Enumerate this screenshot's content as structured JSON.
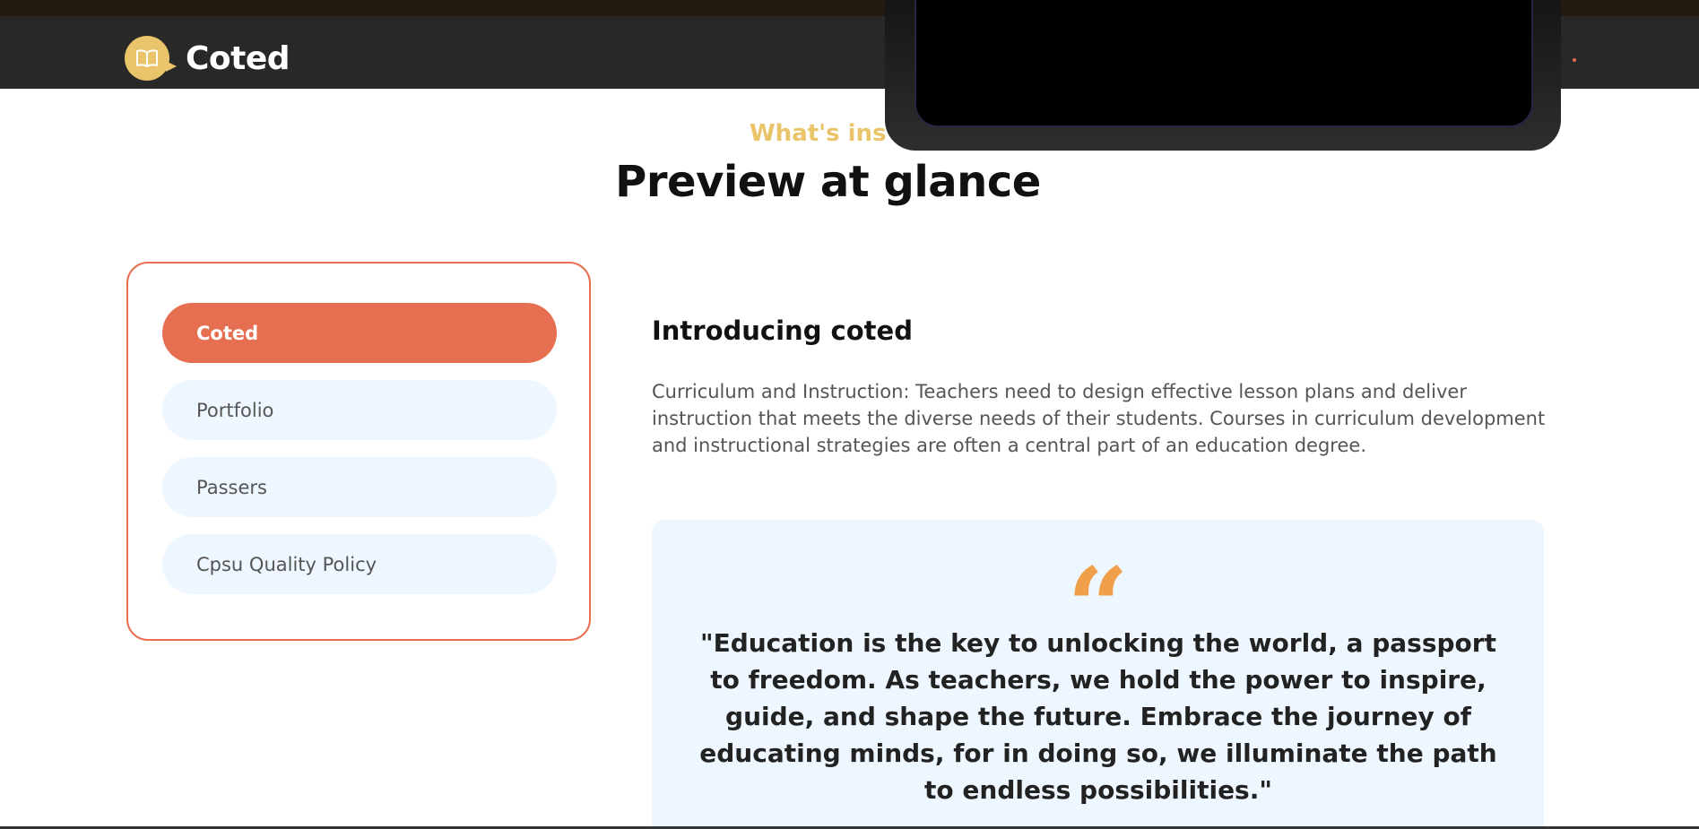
{
  "brand": {
    "name": "Coted",
    "logo_icon": "open-book-icon"
  },
  "section": {
    "eyebrow": "What's ins",
    "title": "Preview at glance"
  },
  "tabs": [
    {
      "label": "Coted",
      "active": true
    },
    {
      "label": "Portfolio",
      "active": false
    },
    {
      "label": "Passers",
      "active": false
    },
    {
      "label": "Cpsu Quality Policy",
      "active": false
    }
  ],
  "content": {
    "title": "Introducing coted",
    "body": "Curriculum and Instruction: Teachers need to design effective lesson plans and deliver instruction that meets the diverse needs of their students. Courses in curriculum development and instructional strategies are often a central part of an education degree.",
    "quote_icon": "quote-icon",
    "quote_mark": "“",
    "quote": "\"Education is the key to unlocking the world, a passport to freedom. As teachers, we hold the power to inspire, guide, and shape the future. Embrace the journey of educating minds, for in doing so, we illuminate the path to endless possibilities.\""
  },
  "colors": {
    "accent": "#e76f51",
    "gold": "#e9c46a",
    "nav_bg": "#282828",
    "tab_bg": "#eef6ff",
    "quote_mark": "#f0a04b"
  }
}
